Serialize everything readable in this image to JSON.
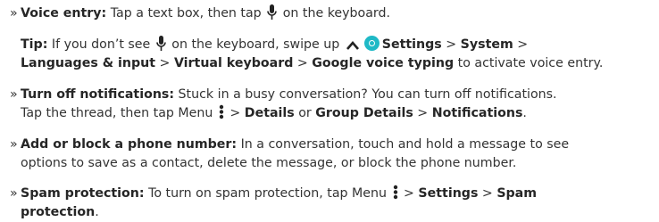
{
  "bullet": "»",
  "items": {
    "voice": {
      "title": "Voice entry:",
      "text1": " Tap a text box, then tap ",
      "text2": " on the keyboard."
    },
    "tip": {
      "title": "Tip:",
      "text1": " If you don’t see ",
      "text2": " on the keyboard, swipe up ",
      "settings": "Settings",
      "sep": " > ",
      "system": "System",
      "sep2": " >",
      "languages": "Languages & input",
      "sep3": " > ",
      "virtual": "Virtual keyboard",
      "sep4": " > ",
      "google": "Google voice typing",
      "text3": " to activate voice entry."
    },
    "notif": {
      "title": "Turn off notifications:",
      "text1": " Stuck in a busy conversation? You can turn off notifications.",
      "text2": "Tap the thread, then tap Menu ",
      "sep1": " > ",
      "details": "Details",
      "or": " or ",
      "group": "Group Details",
      "sep2": " > ",
      "notifications": "Notifications",
      "end": "."
    },
    "block": {
      "title": "Add or block a phone number:",
      "text1": " In a conversation, touch and hold a message to see",
      "text2": "options to save as a contact, delete the message, or block the phone number."
    },
    "spam": {
      "title": "Spam protection:",
      "text1": " To turn on spam protection, tap Menu ",
      "sep1": " > ",
      "settings": "Settings",
      "sep2": " > ",
      "spam_label": "Spam",
      "protection": "protection",
      "end": "."
    }
  },
  "colors": {
    "text": "#333333",
    "settings_icon": "#1fb9c6"
  },
  "icons": [
    "microphone-icon",
    "chevron-up-icon",
    "settings-gear-icon",
    "menu-dots-icon"
  ]
}
